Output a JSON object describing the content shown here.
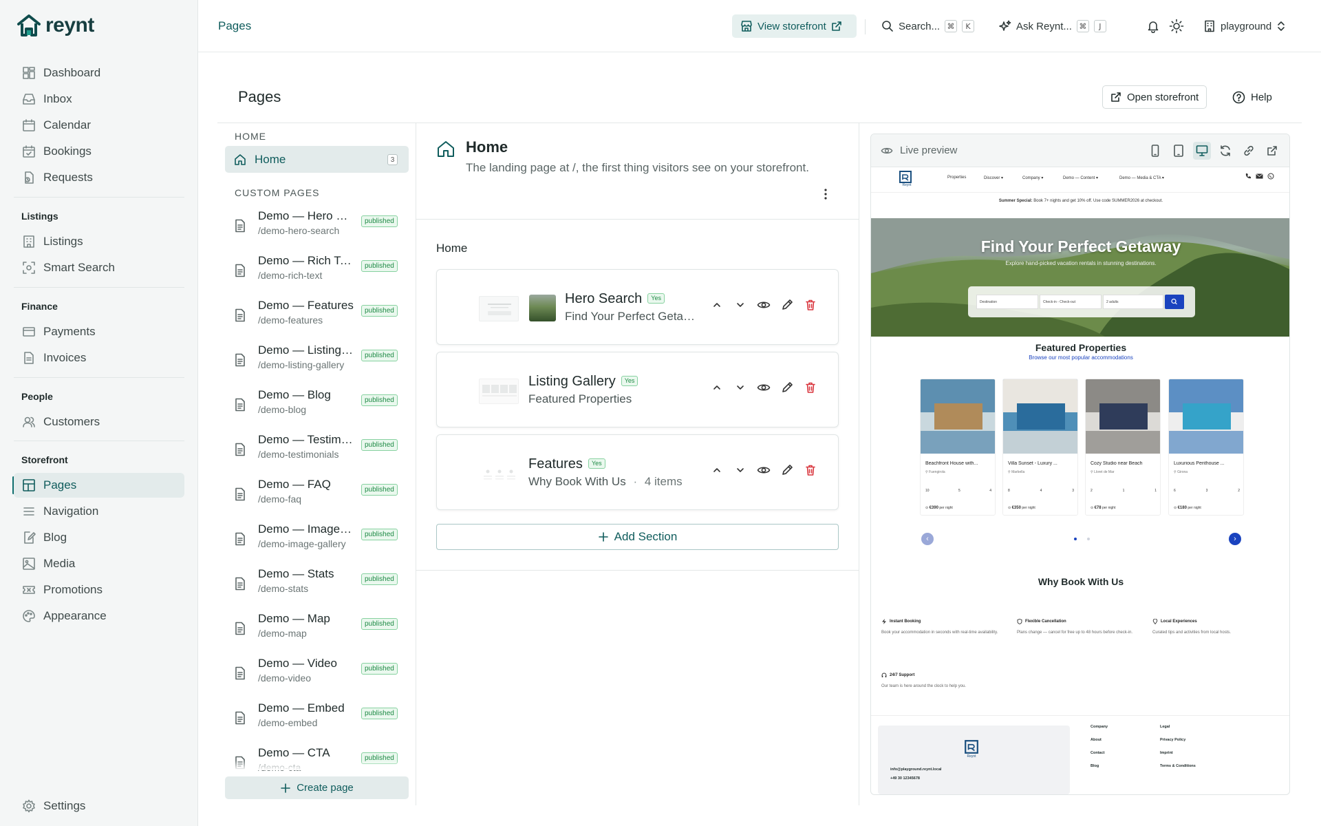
{
  "brand": {
    "name": "reynt"
  },
  "sidebar": {
    "main": [
      {
        "label": "Dashboard",
        "icon": "dashboard-icon"
      },
      {
        "label": "Inbox",
        "icon": "inbox-icon"
      },
      {
        "label": "Calendar",
        "icon": "calendar-icon"
      },
      {
        "label": "Bookings",
        "icon": "bookings-icon"
      },
      {
        "label": "Requests",
        "icon": "requests-icon"
      }
    ],
    "listings_title": "Listings",
    "listings": [
      {
        "label": "Listings",
        "icon": "building-icon"
      },
      {
        "label": "Smart Search",
        "icon": "smart-search-icon"
      }
    ],
    "finance_title": "Finance",
    "finance": [
      {
        "label": "Payments",
        "icon": "credit-card-icon"
      },
      {
        "label": "Invoices",
        "icon": "invoice-icon"
      }
    ],
    "people_title": "People",
    "people": [
      {
        "label": "Customers",
        "icon": "users-icon"
      }
    ],
    "storefront_title": "Storefront",
    "storefront": [
      {
        "label": "Pages",
        "icon": "layout-icon",
        "active": true
      },
      {
        "label": "Navigation",
        "icon": "menu-icon"
      },
      {
        "label": "Blog",
        "icon": "blog-icon"
      },
      {
        "label": "Media",
        "icon": "image-icon"
      },
      {
        "label": "Promotions",
        "icon": "ticket-icon"
      },
      {
        "label": "Appearance",
        "icon": "palette-icon"
      }
    ],
    "settings": "Settings"
  },
  "topbar": {
    "breadcrumb": "Pages",
    "view_storefront": "View storefront",
    "search": "Search...",
    "search_keys": [
      "⌘",
      "K"
    ],
    "ask": "Ask Reynt...",
    "ask_keys": [
      "⌘",
      "J"
    ],
    "workspace": "playground"
  },
  "content": {
    "title": "Pages",
    "open_storefront": "Open storefront",
    "help": "Help"
  },
  "pages_list": {
    "home_label": "HOME",
    "home_item": {
      "name": "Home",
      "count": "3"
    },
    "custom_label": "CUSTOM PAGES",
    "status": "published",
    "items": [
      {
        "name": "Demo — Hero Search",
        "slug": "/demo-hero-search"
      },
      {
        "name": "Demo — Rich Text",
        "slug": "/demo-rich-text"
      },
      {
        "name": "Demo — Features",
        "slug": "/demo-features"
      },
      {
        "name": "Demo — Listing Gallery",
        "slug": "/demo-listing-gallery"
      },
      {
        "name": "Demo — Blog",
        "slug": "/demo-blog"
      },
      {
        "name": "Demo — Testimonials",
        "slug": "/demo-testimonials"
      },
      {
        "name": "Demo — FAQ",
        "slug": "/demo-faq"
      },
      {
        "name": "Demo — Image Gallery",
        "slug": "/demo-image-gallery"
      },
      {
        "name": "Demo — Stats",
        "slug": "/demo-stats"
      },
      {
        "name": "Demo — Map",
        "slug": "/demo-map"
      },
      {
        "name": "Demo — Video",
        "slug": "/demo-video"
      },
      {
        "name": "Demo — Embed",
        "slug": "/demo-embed"
      },
      {
        "name": "Demo — CTA",
        "slug": "/demo-cta"
      }
    ],
    "create_page": "Create page"
  },
  "editor": {
    "title": "Home",
    "subtitle": "The landing page at /, the first thing visitors see on your storefront.",
    "sections_heading": "Home",
    "sections": [
      {
        "title": "Hero Search",
        "badge": "Yes",
        "subtitle": "Find Your Perfect Getaway"
      },
      {
        "title": "Listing Gallery",
        "badge": "Yes",
        "subtitle": "Featured Properties"
      },
      {
        "title": "Features",
        "badge": "Yes",
        "subtitle": "Why Book With Us",
        "meta": "4 items"
      }
    ],
    "add_section": "Add Section"
  },
  "preview": {
    "label": "Live preview",
    "site": {
      "nav": [
        "Properties",
        "Discover ▾",
        "Company ▾",
        "Demo — Content ▾",
        "Demo — Media & CTA ▾"
      ],
      "logo_text": "Reynt",
      "promo_bold": "Summer Special:",
      "promo_text": "Book 7+ nights and get 10% off. Use code SUMMER2026 at checkout.",
      "hero_title": "Find Your Perfect Getaway",
      "hero_sub": "Explore hand-picked vacation rentals in stunning destinations.",
      "hero_fields": [
        "Destination",
        "Check-in - Check-out",
        "2 adults"
      ],
      "fp_title": "Featured Properties",
      "fp_sub": "Browse our most popular accommodations",
      "properties": [
        {
          "name": "Beachfront House with...",
          "loc": "Fuengirola",
          "stats": [
            "10",
            "5",
            "4"
          ],
          "price": "€390",
          "per": "per night",
          "colors": [
            "#5d8fb0",
            "#c9d8de",
            "#b08b5a"
          ]
        },
        {
          "name": "Villa Sunset - Luxury ...",
          "loc": "Marbella",
          "stats": [
            "8",
            "4",
            "3"
          ],
          "price": "€350",
          "per": "per night",
          "colors": [
            "#e9e6e0",
            "#4f8fb8",
            "#2a6c9c"
          ]
        },
        {
          "name": "Cozy Studio near Beach",
          "loc": "Lloret de Mar",
          "stats": [
            "2",
            "1",
            "1"
          ],
          "price": "€78",
          "per": "per night",
          "colors": [
            "#8c8a86",
            "#dcdad6",
            "#2f3c5a"
          ]
        },
        {
          "name": "Luxurious Penthouse ...",
          "loc": "Girona",
          "stats": [
            "6",
            "3",
            "2"
          ],
          "price": "€180",
          "per": "per night",
          "colors": [
            "#5c8fc4",
            "#eeeeee",
            "#35a3c9"
          ]
        }
      ],
      "why_title": "Why Book With Us",
      "features": [
        {
          "title": "Instant Booking",
          "desc": "Book your accommodation in seconds with real-time availability."
        },
        {
          "title": "Flexible Cancellation",
          "desc": "Plans change — cancel for free up to 48 hours before check-in."
        },
        {
          "title": "Local Experiences",
          "desc": "Curated tips and activities from local hosts."
        },
        {
          "title": "24/7 Support",
          "desc": "Our team is here around the clock to help you."
        }
      ],
      "footer": {
        "email": "info@playground.reynt.local",
        "phone": "+49 30 12345678",
        "company_title": "Company",
        "company_links": [
          "About",
          "Contact",
          "Blog"
        ],
        "legal_title": "Legal",
        "legal_links": [
          "Privacy Policy",
          "Imprint",
          "Terms & Conditions"
        ]
      }
    }
  },
  "colors": {
    "brand": "#0f5c5c",
    "accent_bg": "#e3ebeb",
    "published": "#1e8a45",
    "delete": "#d9363e",
    "site_primary": "#1a43bf"
  }
}
